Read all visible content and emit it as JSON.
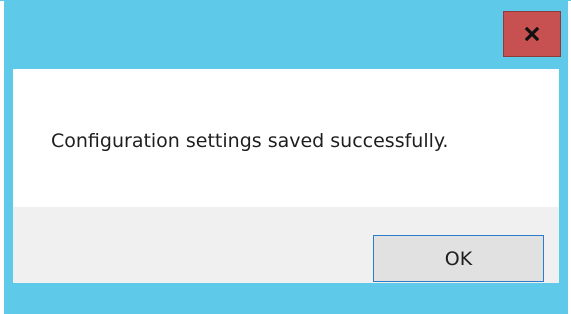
{
  "dialog": {
    "message": "Configuration settings saved successfully.",
    "ok_label": "OK",
    "close_icon": "close-icon"
  },
  "colors": {
    "frame": "#5fc9ea",
    "close_button": "#c75050",
    "button_area": "#f0f0f0",
    "ok_border": "#2c7cc9"
  }
}
